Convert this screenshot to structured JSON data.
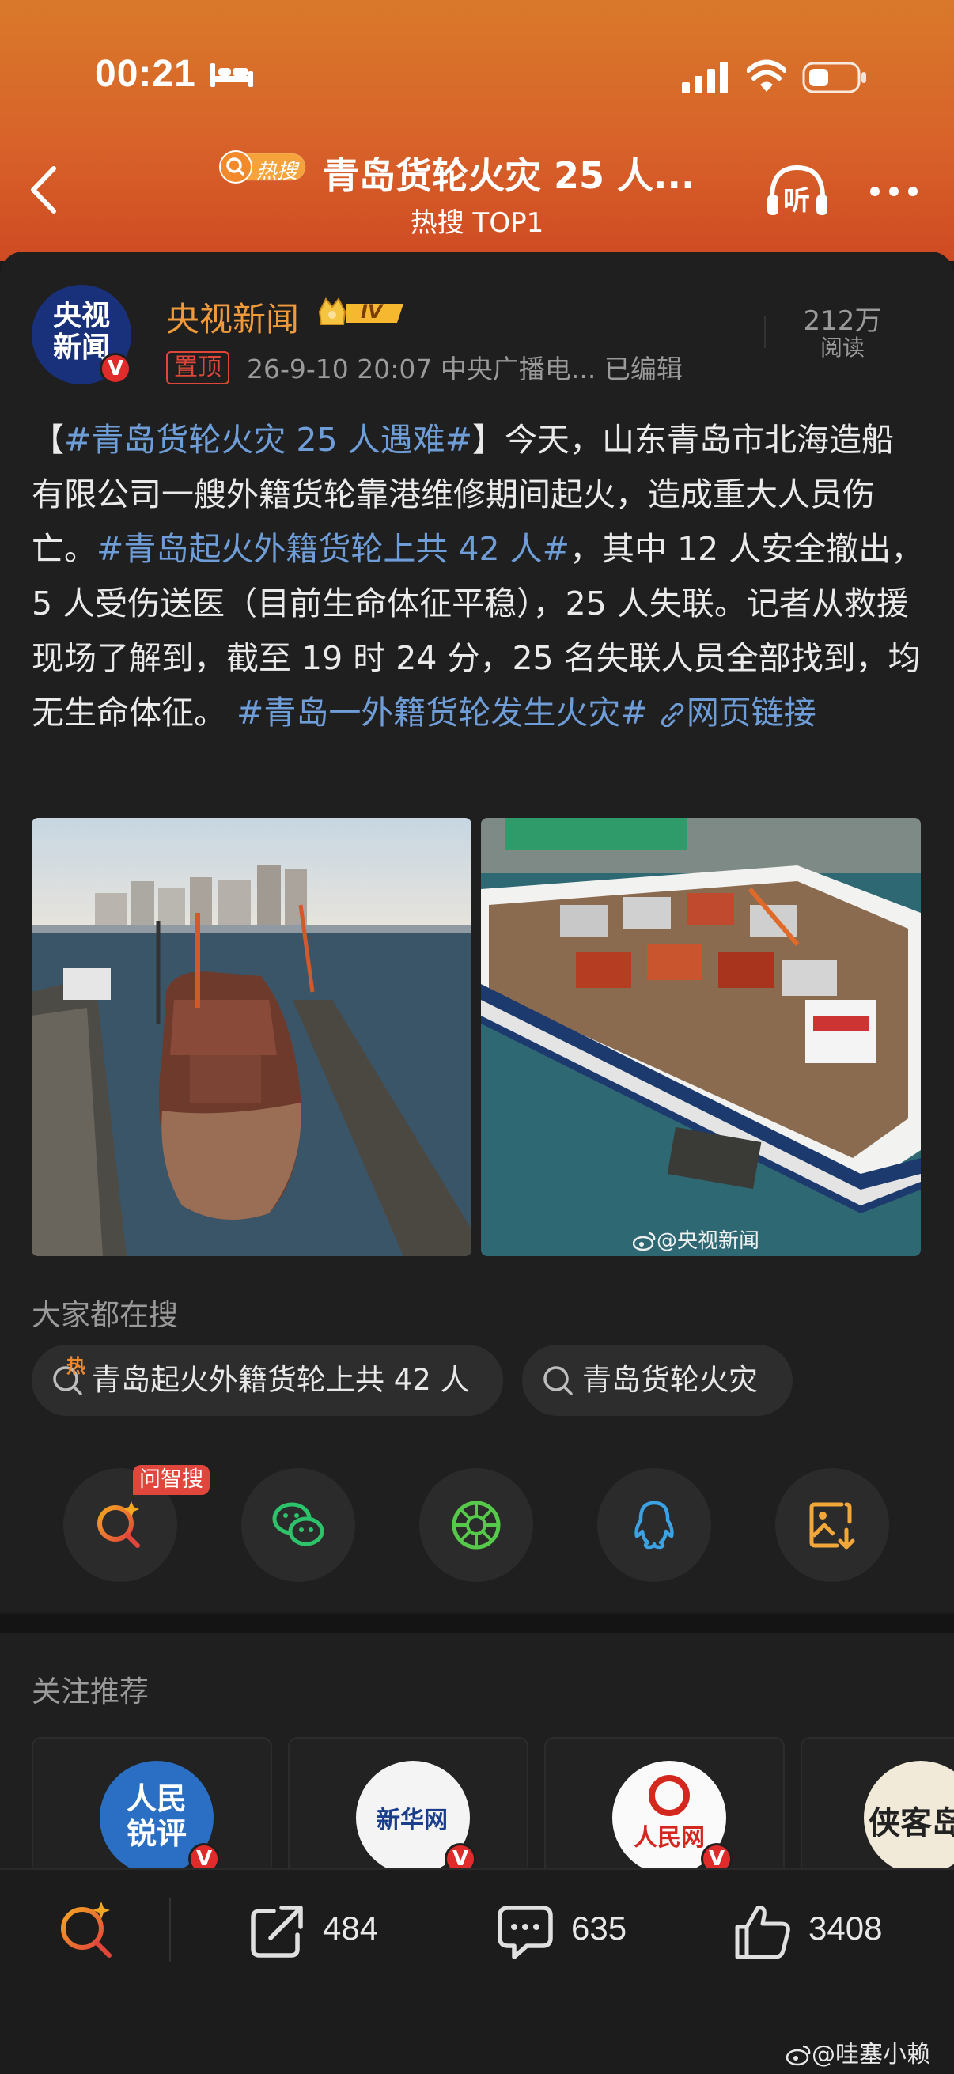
{
  "status_bar": {
    "time": "00:21"
  },
  "header": {
    "hot_badge": "热搜",
    "title": "青岛货轮火灾 25 人...",
    "subtitle": "热搜 TOP1",
    "listen_label": "听"
  },
  "post": {
    "avatar_text": "央视新闻",
    "author": "央视新闻",
    "level": "IV",
    "pinned": "置顶",
    "meta": "26-9-10 20:07  中央广播电...  已编辑",
    "views_count": "212万",
    "views_label": "阅读",
    "text": {
      "p1_open": "【",
      "tag1": "#青岛货轮火灾 25 人遇难#",
      "p1_close": "】今天，山东青岛市北海造船有限公司一艘外籍货轮靠港维修期间起火，造成重大人员伤亡。",
      "tag2": "#青岛起火外籍货轮上共 42 人#",
      "p2": "，其中 12 人安全撤出，5 人受伤送医（目前生命体征平稳），25 人失联。记者从救援现场了解到，截至 19 时 24 分，25 名失联人员全部找到，均无生命体征。",
      "tag3": "#青岛一外籍货轮发生火灾#",
      "link": "网页链接"
    },
    "watermark": "@央视新闻"
  },
  "search_section": {
    "label": "大家都在搜",
    "pills": [
      {
        "text": "青岛起火外籍货轮上共 42 人",
        "hot_marker": "热"
      },
      {
        "text": "青岛货轮火灾"
      }
    ]
  },
  "share": {
    "zhi_tag": "问智搜",
    "buttons": [
      "ai-search",
      "wechat",
      "moments",
      "qq",
      "save-image"
    ]
  },
  "recommend": {
    "label": "关注推荐",
    "accounts": [
      {
        "logo_text": "人民锐评"
      },
      {
        "logo_text": "新华网"
      },
      {
        "logo_text": "人民网"
      },
      {
        "logo_text": "侠客岛"
      }
    ]
  },
  "bottom_bar": {
    "reposts": "484",
    "comments": "635",
    "likes": "3408"
  },
  "credit": "@哇塞小赖",
  "colors": {
    "header_top": "#d9792a",
    "header_bottom": "#cf4a22",
    "author": "#f19a3a",
    "tag": "#6f9dd8",
    "badge_red": "#e0463b"
  }
}
